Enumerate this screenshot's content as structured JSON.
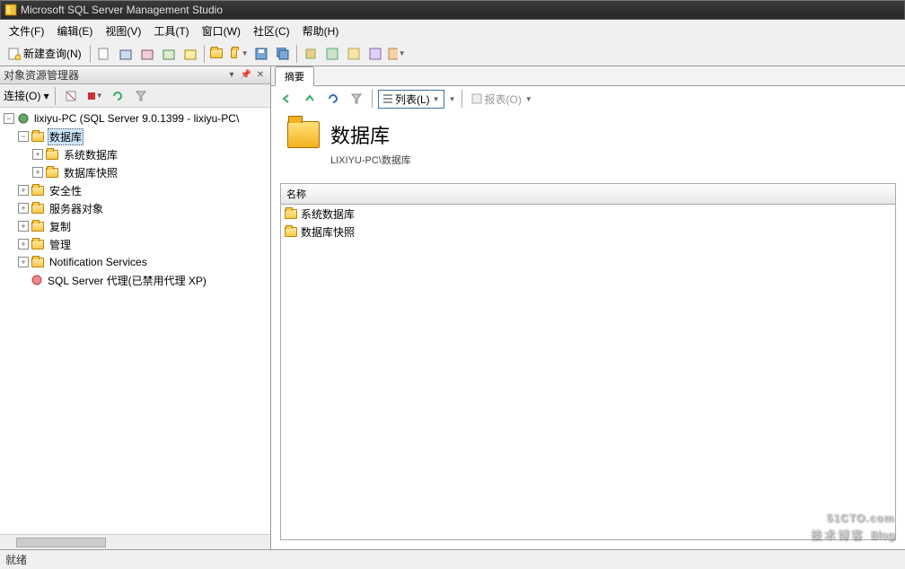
{
  "title": "Microsoft SQL Server Management Studio",
  "menus": {
    "file": "文件(F)",
    "edit": "编辑(E)",
    "view": "视图(V)",
    "tools": "工具(T)",
    "window": "窗口(W)",
    "community": "社区(C)",
    "help": "帮助(H)"
  },
  "toolbar": {
    "newquery": "新建查询(N)"
  },
  "panel": {
    "title": "对象资源管理器",
    "connect": "连接(O)"
  },
  "tree": {
    "root": "lixiyu-PC (SQL Server 9.0.1399 - lixiyu-PC\\",
    "db": "数据库",
    "sysdb": "系统数据库",
    "dbsnap": "数据库快照",
    "security": "安全性",
    "serverobj": "服务器对象",
    "replication": "复制",
    "management": "管理",
    "notif": "Notification Services",
    "agent": "SQL Server 代理(已禁用代理 XP)"
  },
  "summary": {
    "tab": "摘要",
    "listbtn": "列表(L)",
    "report": "报表(O)",
    "title": "数据库",
    "path": "LIXIYU-PC\\数据库",
    "colname": "名称",
    "row1": "系统数据库",
    "row2": "数据库快照"
  },
  "status": "就绪",
  "watermark": {
    "line1": "51CTO.com",
    "line2": "技术博客",
    "tag": "Blog"
  }
}
